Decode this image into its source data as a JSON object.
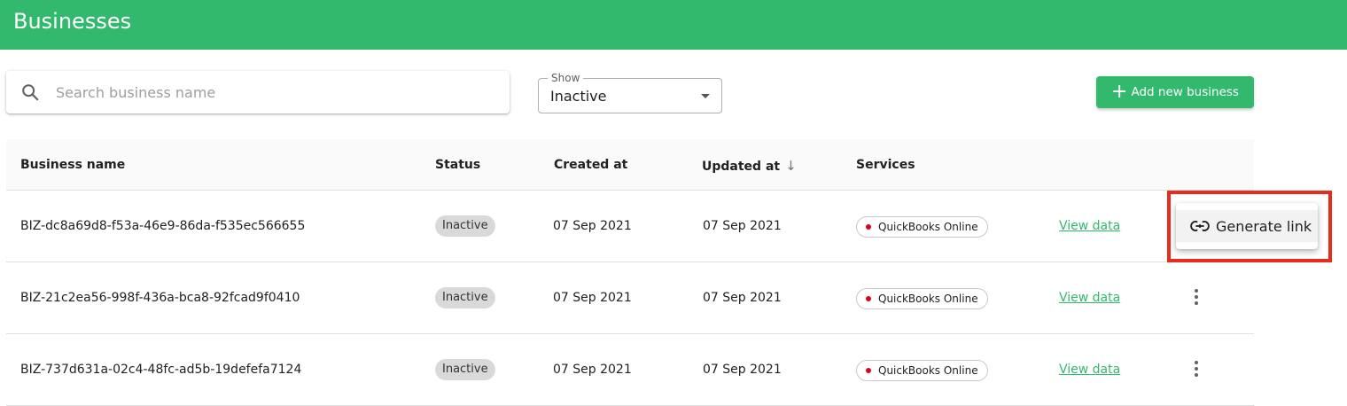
{
  "header": {
    "title": "Businesses"
  },
  "search": {
    "placeholder": "Search business name",
    "value": ""
  },
  "filter": {
    "label": "Show",
    "selected": "Inactive"
  },
  "add_button": {
    "label": "Add new business",
    "icon": "plus-icon"
  },
  "table": {
    "columns": [
      "Business name",
      "Status",
      "Created at",
      "Updated at",
      "Services"
    ],
    "sort_column": "Updated at",
    "sort_direction": "descending",
    "rows": [
      {
        "name": "BIZ-dc8a69d8-f53a-46e9-86da-f535ec566655",
        "status": "Inactive",
        "created": "07 Sep 2021",
        "updated": "07 Sep 2021",
        "service": "QuickBooks Online",
        "link": "View data"
      },
      {
        "name": "BIZ-21c2ea56-998f-436a-bca8-92fcad9f0410",
        "status": "Inactive",
        "created": "07 Sep 2021",
        "updated": "07 Sep 2021",
        "service": "QuickBooks Online",
        "link": "View data"
      },
      {
        "name": "BIZ-737d631a-02c4-48fc-ad5b-19defefa7124",
        "status": "Inactive",
        "created": "07 Sep 2021",
        "updated": "07 Sep 2021",
        "service": "QuickBooks Online",
        "link": "View data"
      }
    ]
  },
  "row_menu": {
    "item_label": "Generate link",
    "icon": "link-icon"
  },
  "colors": {
    "brand": "#32b96e",
    "highlight": "#ea2a1a",
    "service_dot": "#e0001b"
  }
}
